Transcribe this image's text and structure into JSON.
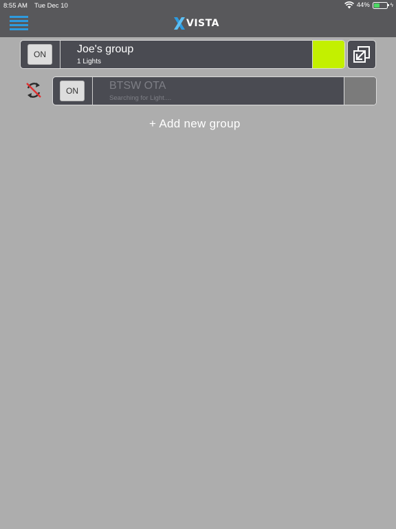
{
  "status_bar": {
    "time": "8:55 AM",
    "date": "Tue Dec 10",
    "battery_percent": "44%",
    "battery_level": 0.44
  },
  "navbar": {
    "logo_text": "VISTA",
    "menu_icon": "hamburger-menu-icon"
  },
  "groups": [
    {
      "on_label": "ON",
      "name": "Joe's group",
      "subtitle": "1 Lights",
      "color": "#c3f000"
    },
    {
      "on_label": "ON",
      "name": "BTSW OTA",
      "subtitle": "Searching for Light....",
      "color": "#7b7b7b"
    }
  ],
  "add_group_label": "+ Add new group",
  "colors": {
    "bar_background": "#58585b",
    "page_background": "#adadad",
    "row_background": "#4a4b52",
    "accent_blue": "#2d9be0",
    "sync_error_red": "#e03030"
  }
}
